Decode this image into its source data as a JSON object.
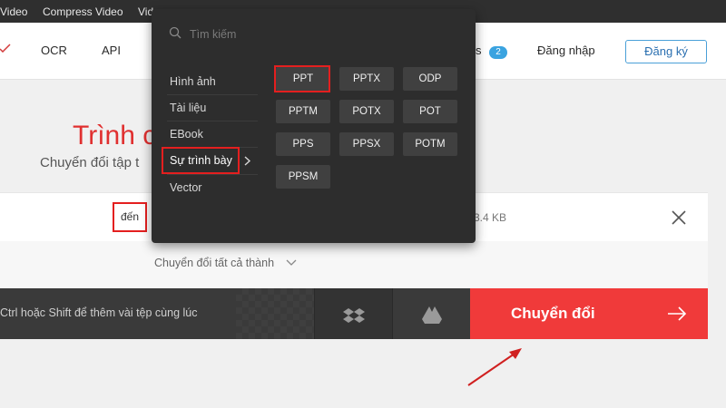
{
  "topbar": {
    "items": [
      "Video",
      "Compress Video",
      "Vid"
    ]
  },
  "header": {
    "nav": [
      "OCR",
      "API",
      "s"
    ],
    "jobs_badge": "2",
    "login": "Đăng nhập",
    "register": "Đăng ký"
  },
  "hero": {
    "title": "Trình c",
    "subtitle": "Chuyển đổi tập t"
  },
  "file_row": {
    "to_label": "đến",
    "file_size": "3.4 KB"
  },
  "convert_all": "Chuyển đổi tất cả thành",
  "bottom_bar": {
    "hint": "Ctrl hoặc Shift để thêm vài tệp cùng lúc",
    "convert_button": "Chuyển đổi"
  },
  "dropdown": {
    "search_placeholder": "Tìm kiếm",
    "categories": [
      "Hình ảnh",
      "Tài liệu",
      "EBook",
      "Sự trình bày",
      "Vector"
    ],
    "selected_category": "Sự trình bày",
    "formats": [
      "PPT",
      "PPTX",
      "ODP",
      "PPTM",
      "POTX",
      "POT",
      "PPS",
      "PPSX",
      "POTM",
      "PPSM"
    ],
    "selected_format": "PPT"
  },
  "colors": {
    "accent_red": "#f03a3a",
    "highlight_red": "#e41f1f",
    "dropdown_bg": "#2d2d2d",
    "badge_blue": "#3aa3e0"
  }
}
